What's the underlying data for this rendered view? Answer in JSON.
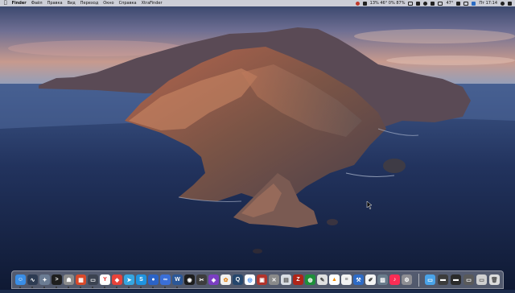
{
  "menubar": {
    "apple": "",
    "app_name": "Finder",
    "menus": [
      "Файл",
      "Правка",
      "Вид",
      "Переход",
      "Окно",
      "Справка",
      "XtraFinder"
    ],
    "status": {
      "network": "13% 46° 0% 87%",
      "temperature": "47°",
      "clock": "Пт 17:14"
    }
  },
  "dock": {
    "left_apps": [
      {
        "name": "finder-icon",
        "color": "#3a8ee6",
        "glyph": "☺"
      },
      {
        "name": "activity-monitor-icon",
        "color": "#2d3b52",
        "glyph": "∿"
      },
      {
        "name": "launchpad-icon",
        "color": "#6b7c93",
        "glyph": "✦"
      },
      {
        "name": "terminal-icon",
        "color": "#1e1e1e",
        "glyph": ">"
      },
      {
        "name": "automator-icon",
        "color": "#8c8c8c",
        "glyph": "☗"
      },
      {
        "name": "app-grid-icon",
        "color": "#d84a2b",
        "glyph": "▦"
      },
      {
        "name": "screen-icon",
        "color": "#3b4250",
        "glyph": "▭"
      },
      {
        "name": "yandex-browser-icon",
        "color": "#ffffff",
        "glyph": "Y",
        "glyph_color": "#e52620"
      },
      {
        "name": "anydesk-icon",
        "color": "#e8433a",
        "glyph": "◆"
      },
      {
        "name": "telegram-icon",
        "color": "#36a6e0",
        "glyph": "➤"
      },
      {
        "name": "skype-icon",
        "color": "#1f94e0",
        "glyph": "S"
      },
      {
        "name": "app-blue-circle-icon",
        "color": "#2b63c6",
        "glyph": "●"
      },
      {
        "name": "pages-icon",
        "color": "#3a6fd8",
        "glyph": "∞"
      },
      {
        "name": "word-icon",
        "color": "#2b5797",
        "glyph": "W"
      },
      {
        "name": "obs-icon",
        "color": "#1d1d1d",
        "glyph": "◉"
      },
      {
        "name": "final-cut-icon",
        "color": "#3d3d3d",
        "glyph": "✂"
      },
      {
        "name": "motion-icon",
        "color": "#7a3ec2",
        "glyph": "◈"
      },
      {
        "name": "photos-icon",
        "color": "#f0f0f0",
        "glyph": "✿",
        "glyph_color": "#e0841e"
      },
      {
        "name": "quicktime-icon",
        "color": "#25466c",
        "glyph": "Q"
      },
      {
        "name": "chrome-icon",
        "color": "#ffffff",
        "glyph": "◎",
        "glyph_color": "#1a73e8"
      },
      {
        "name": "photo-booth-icon",
        "color": "#b2342c",
        "glyph": "▣"
      },
      {
        "name": "utilities-icon",
        "color": "#8a8a8a",
        "glyph": "✕"
      },
      {
        "name": "preview-icon",
        "color": "#d9dde3",
        "glyph": "▤",
        "glyph_color": "#555"
      },
      {
        "name": "filezilla-icon",
        "color": "#b02418",
        "glyph": "Z"
      },
      {
        "name": "camo-icon",
        "color": "#1e8f3a",
        "glyph": "◍"
      },
      {
        "name": "script-editor-icon",
        "color": "#e0e0e0",
        "glyph": "✎",
        "glyph_color": "#444"
      },
      {
        "name": "vlc-icon",
        "color": "#ffffff",
        "glyph": "▲",
        "glyph_color": "#f08a00"
      },
      {
        "name": "notes-icon",
        "color": "#f2f2f2",
        "glyph": "≡",
        "glyph_color": "#666"
      },
      {
        "name": "xcode-icon",
        "color": "#2e6bc6",
        "glyph": "⚒"
      },
      {
        "name": "textedit-icon",
        "color": "#f4f4f4",
        "glyph": "✐",
        "glyph_color": "#333"
      },
      {
        "name": "image-capture-icon",
        "color": "#6a7c8c",
        "glyph": "▨"
      },
      {
        "name": "music-icon",
        "color": "#fa2d55",
        "glyph": "♪"
      },
      {
        "name": "system-preferences-icon",
        "color": "#8e8e93",
        "glyph": "⚙"
      }
    ],
    "right_items": [
      {
        "name": "applications-folder-icon",
        "color": "#4aa3e8",
        "glyph": "▭"
      },
      {
        "name": "stack-folder-icon",
        "color": "#3c3c3c",
        "glyph": "▬"
      },
      {
        "name": "downloads-folder-icon",
        "color": "#2b2b2b",
        "glyph": "▬"
      },
      {
        "name": "screenshots-stack-icon",
        "color": "#5a5a5a",
        "glyph": "▭"
      },
      {
        "name": "documents-stack-icon",
        "color": "#d0d0d0",
        "glyph": "▭",
        "glyph_color": "#555"
      },
      {
        "name": "trash-icon",
        "color": "#dcdcdc",
        "glyph": "🗑",
        "glyph_color": "#555"
      }
    ]
  }
}
